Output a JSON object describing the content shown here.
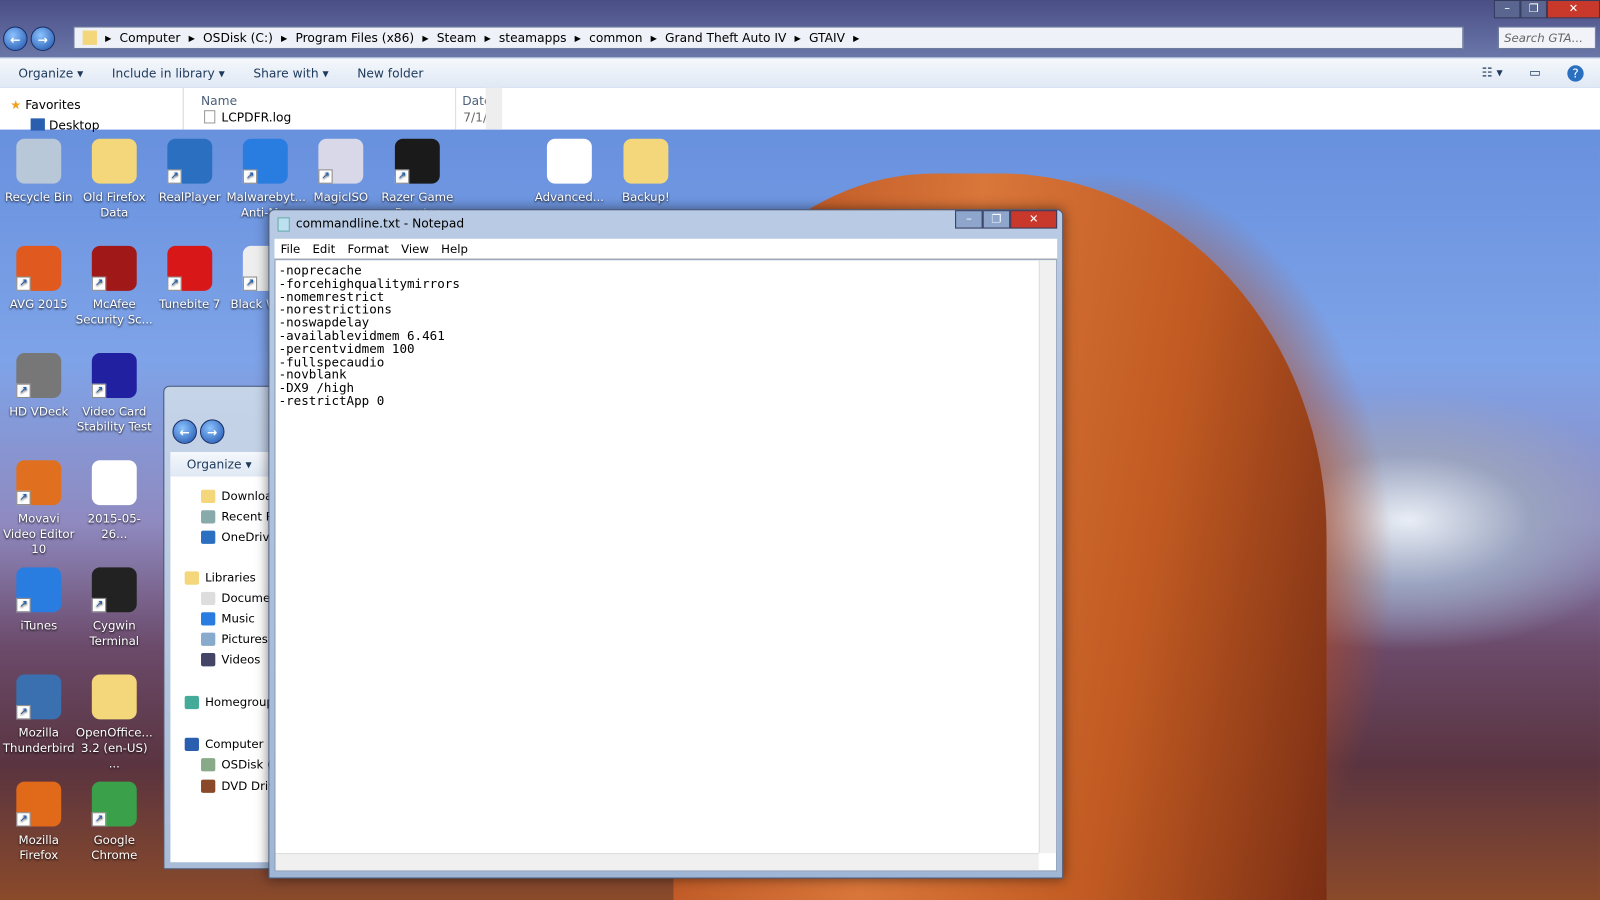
{
  "explorer": {
    "breadcrumb": [
      "Computer",
      "OSDisk (C:)",
      "Program Files (x86)",
      "Steam",
      "steamapps",
      "common",
      "Grand Theft Auto IV",
      "GTAIV"
    ],
    "search_placeholder": "Search GTA...",
    "toolbar": {
      "organize": "Organize",
      "include": "Include in library",
      "share": "Share with",
      "new_folder": "New folder"
    },
    "nav": {
      "favorites": "Favorites",
      "desktop": "Desktop"
    },
    "columns": {
      "name": "Name",
      "date": "Date"
    },
    "files": [
      {
        "name": "LCPDFR.log",
        "date": "7/1/"
      }
    ]
  },
  "desktop_icons": [
    {
      "label": "Recycle Bin",
      "color": "#b8c8d8"
    },
    {
      "label": "Old Firefox Data",
      "color": "#f3d77a"
    },
    {
      "label": "RealPlayer",
      "color": "#2a6fc0"
    },
    {
      "label": "Malwarebyt... Anti-M...",
      "color": "#2a7de0"
    },
    {
      "label": "MagicISO",
      "color": "#d8d8e8"
    },
    {
      "label": "Razer Game Booster",
      "color": "#1a1a1a"
    },
    {
      "label": "Advanced...",
      "color": "#ffffff"
    },
    {
      "label": "Backup!",
      "color": "#f3d77a"
    },
    {
      "label": "AVG 2015",
      "color": "#e05a20"
    },
    {
      "label": "McAfee Security Sc...",
      "color": "#a01818"
    },
    {
      "label": "Tunebite 7",
      "color": "#d81818"
    },
    {
      "label": "Black White",
      "color": "#eeeeee"
    },
    {
      "label": "HD VDeck",
      "color": "#777777"
    },
    {
      "label": "Video Card Stability Test",
      "color": "#2020a0"
    },
    {
      "label": "Movavi Video Editor 10",
      "color": "#e07020"
    },
    {
      "label": "2015-05-26...",
      "color": "#ffffff"
    },
    {
      "label": "iTunes",
      "color": "#2a7de0"
    },
    {
      "label": "Cygwin Terminal",
      "color": "#222222"
    },
    {
      "label": "Mozilla Thunderbird",
      "color": "#3a6fb0"
    },
    {
      "label": "OpenOffice... 3.2 (en-US) ...",
      "color": "#f3d77a"
    },
    {
      "label": "Mozilla Firefox",
      "color": "#e06a1a"
    },
    {
      "label": "Google Chrome",
      "color": "#3aa04a"
    }
  ],
  "explorer2": {
    "organize": "Organize",
    "nav": [
      "Downloads",
      "Recent Places",
      "OneDrive",
      "Libraries",
      "Documents",
      "Music",
      "Pictures",
      "Videos",
      "Homegroup",
      "Computer",
      "OSDisk (C:)",
      "DVD Drive"
    ]
  },
  "notepad": {
    "title": "commandline.txt - Notepad",
    "menu": [
      "File",
      "Edit",
      "Format",
      "View",
      "Help"
    ],
    "lines": [
      "-noprecache",
      "-forcehighqualitymirrors",
      "-nomemrestrict",
      "-norestrictions",
      "-noswapdelay",
      "-availablevidmem 6.461",
      "-percentvidmem 100",
      "-fullspecaudio",
      "-novblank",
      "-DX9 /high",
      "-restrictApp 0"
    ]
  }
}
